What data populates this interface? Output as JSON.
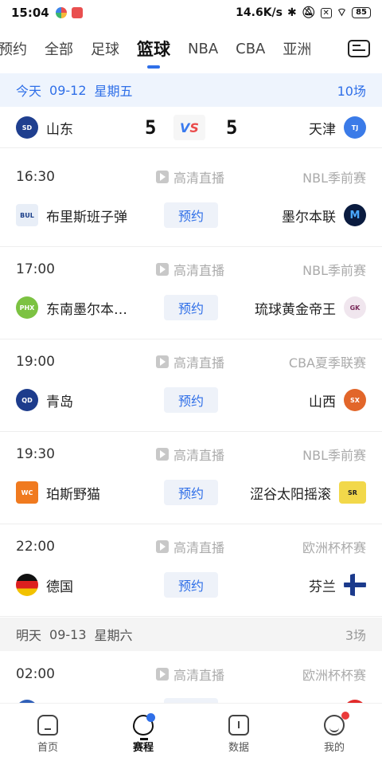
{
  "status": {
    "time": "15:04",
    "net_speed": "14.6K/s",
    "battery": "85"
  },
  "tabs": [
    {
      "label": "预约",
      "active": false
    },
    {
      "label": "全部",
      "active": false
    },
    {
      "label": "足球",
      "active": false
    },
    {
      "label": "篮球",
      "active": true
    },
    {
      "label": "NBA",
      "active": false
    },
    {
      "label": "CBA",
      "active": false
    },
    {
      "label": "亚洲",
      "active": false
    }
  ],
  "sections": [
    {
      "day": "今天",
      "date": "09-12",
      "weekday": "星期五",
      "count": "10场"
    },
    {
      "day": "明天",
      "date": "09-13",
      "weekday": "星期六",
      "count": "3场"
    }
  ],
  "live_match": {
    "home": "山东",
    "home_score": "5",
    "away": "天津",
    "away_score": "5",
    "vs_v": "V",
    "vs_s": "S"
  },
  "matches": [
    {
      "time": "16:30",
      "live_label": "高清直播",
      "league": "NBL季前赛",
      "home": "布里斯班子弹",
      "action": "预约",
      "away": "墨尔本联"
    },
    {
      "time": "17:00",
      "live_label": "高清直播",
      "league": "NBL季前赛",
      "home": "东南墨尔本…",
      "action": "预约",
      "away": "琉球黄金帝王"
    },
    {
      "time": "19:00",
      "live_label": "高清直播",
      "league": "CBA夏季联赛",
      "home": "青岛",
      "action": "预约",
      "away": "山西"
    },
    {
      "time": "19:30",
      "live_label": "高清直播",
      "league": "NBL季前赛",
      "home": "珀斯野猫",
      "action": "预约",
      "away": "涩谷太阳摇滚"
    },
    {
      "time": "22:00",
      "live_label": "高清直播",
      "league": "欧洲杯杯赛",
      "home": "德国",
      "action": "预约",
      "away": "芬兰"
    },
    {
      "time": "02:00",
      "live_label": "高清直播",
      "league": "欧洲杯杯赛",
      "home": "",
      "action": "",
      "away": ""
    }
  ],
  "bottom_nav": [
    {
      "label": "首页",
      "icon": "home-icon",
      "active": false
    },
    {
      "label": "赛程",
      "icon": "trophy-icon",
      "active": true
    },
    {
      "label": "数据",
      "icon": "data-icon",
      "active": false
    },
    {
      "label": "我的",
      "icon": "profile-icon",
      "active": false
    }
  ],
  "colors": {
    "accent": "#2f6fe8",
    "vs_red": "#ea4b4b"
  }
}
